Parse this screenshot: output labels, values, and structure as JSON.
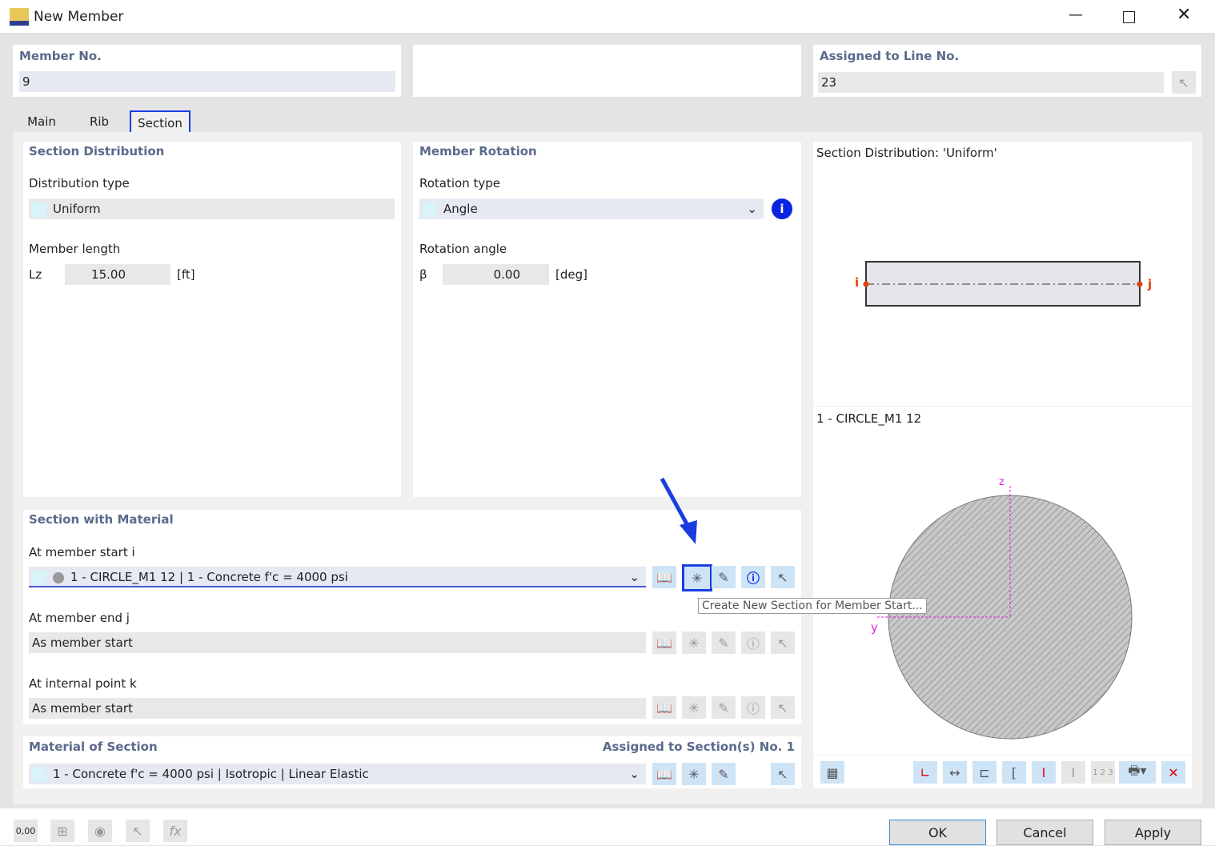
{
  "window": {
    "title": "New Member"
  },
  "member_no": {
    "label": "Member No.",
    "value": "9"
  },
  "assigned_line": {
    "label": "Assigned to Line No.",
    "value": "23"
  },
  "tabs": [
    {
      "label": "Main"
    },
    {
      "label": "Rib"
    },
    {
      "label": "Section",
      "active": true
    }
  ],
  "section_distribution": {
    "header": "Section Distribution",
    "type_label": "Distribution type",
    "type_value": "Uniform",
    "length_label": "Member length",
    "length_symbol": "Lz",
    "length_value": "15.00",
    "length_unit": "[ft]"
  },
  "member_rotation": {
    "header": "Member Rotation",
    "type_label": "Rotation type",
    "type_value": "Angle",
    "angle_label": "Rotation angle",
    "angle_symbol": "β",
    "angle_value": "0.00",
    "angle_unit": "[deg]"
  },
  "section_with_material": {
    "header": "Section with Material",
    "start_label": "At member start i",
    "start_value": "1 - CIRCLE_M1 12 | 1 - Concrete f'c = 4000 psi",
    "end_label": "At member end j",
    "end_value": "As member start",
    "internal_label": "At internal point k",
    "internal_value": "As member start"
  },
  "tooltip": "Create New Section for Member Start...",
  "material": {
    "header": "Material of Section",
    "assigned": "Assigned to Section(s) No. 1",
    "value": "1 - Concrete f'c = 4000 psi | Isotropic | Linear Elastic"
  },
  "preview": {
    "distribution_title": "Section Distribution: 'Uniform'",
    "node_i": "i",
    "node_j": "j",
    "section_title": "1 - CIRCLE_M1 12",
    "axis_z": "z",
    "axis_y": "y"
  },
  "bottom_icons": {
    "value_icon_text": "0,00"
  },
  "buttons": {
    "ok": "OK",
    "cancel": "Cancel",
    "apply": "Apply"
  },
  "colors": {
    "accent": "#1a3de0",
    "header": "#5a6a8c",
    "axis": "#e020e0"
  }
}
